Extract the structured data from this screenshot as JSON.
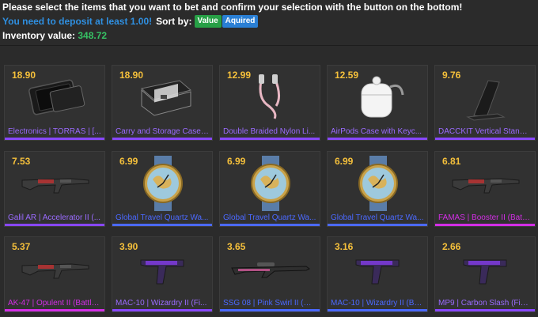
{
  "header": {
    "instruction": "Please select the items that you want to bet and confirm your selection with the button on the bottom!",
    "deposit_warning": "You need to deposit at least 1.00!",
    "sort_label": "Sort by:",
    "sort_value": "Value",
    "sort_acquired": "Aquired",
    "inventory_label": "Inventory value:",
    "inventory_value": "348.72"
  },
  "items": [
    {
      "price": "18.90",
      "name": "Electronics | TORRAS | [...",
      "rarity": "purple",
      "icon": "phone-icon"
    },
    {
      "price": "18.90",
      "name": "Carry and Storage Case ...",
      "rarity": "purple",
      "icon": "case-icon"
    },
    {
      "price": "12.99",
      "name": "Double Braided Nylon Li...",
      "rarity": "purple",
      "icon": "cable-icon"
    },
    {
      "price": "12.59",
      "name": "AirPods Case with Keyc...",
      "rarity": "purple",
      "icon": "airpods-case-icon"
    },
    {
      "price": "9.76",
      "name": "DACCKIT Vertical Stand ...",
      "rarity": "purple",
      "icon": "stand-icon"
    },
    {
      "price": "7.53",
      "name": "Galil AR | Accelerator II (...",
      "rarity": "violet",
      "icon": "rifle-icon"
    },
    {
      "price": "6.99",
      "name": "Global Travel Quartz Wa...",
      "rarity": "blue",
      "icon": "watch-icon"
    },
    {
      "price": "6.99",
      "name": "Global Travel Quartz Wa...",
      "rarity": "blue",
      "icon": "watch-icon"
    },
    {
      "price": "6.99",
      "name": "Global Travel Quartz Wa...",
      "rarity": "blue",
      "icon": "watch-icon"
    },
    {
      "price": "6.81",
      "name": "FAMAS | Booster II (Battl...",
      "rarity": "pink",
      "icon": "rifle-icon"
    },
    {
      "price": "5.37",
      "name": "AK-47 | Opulent II (Battle...",
      "rarity": "pink",
      "icon": "rifle-icon"
    },
    {
      "price": "3.90",
      "name": "MAC-10 | Wizardry II (Fi...",
      "rarity": "violet",
      "icon": "smg-icon"
    },
    {
      "price": "3.65",
      "name": "SSG 08 | Pink Swirl II (Ba...",
      "rarity": "blue",
      "icon": "sniper-icon"
    },
    {
      "price": "3.16",
      "name": "MAC-10 | Wizardry II (Ba...",
      "rarity": "blue",
      "icon": "smg-icon"
    },
    {
      "price": "2.66",
      "name": "MP9 | Carbon Slash (Fiel...",
      "rarity": "violet",
      "icon": "smg-icon"
    }
  ]
}
